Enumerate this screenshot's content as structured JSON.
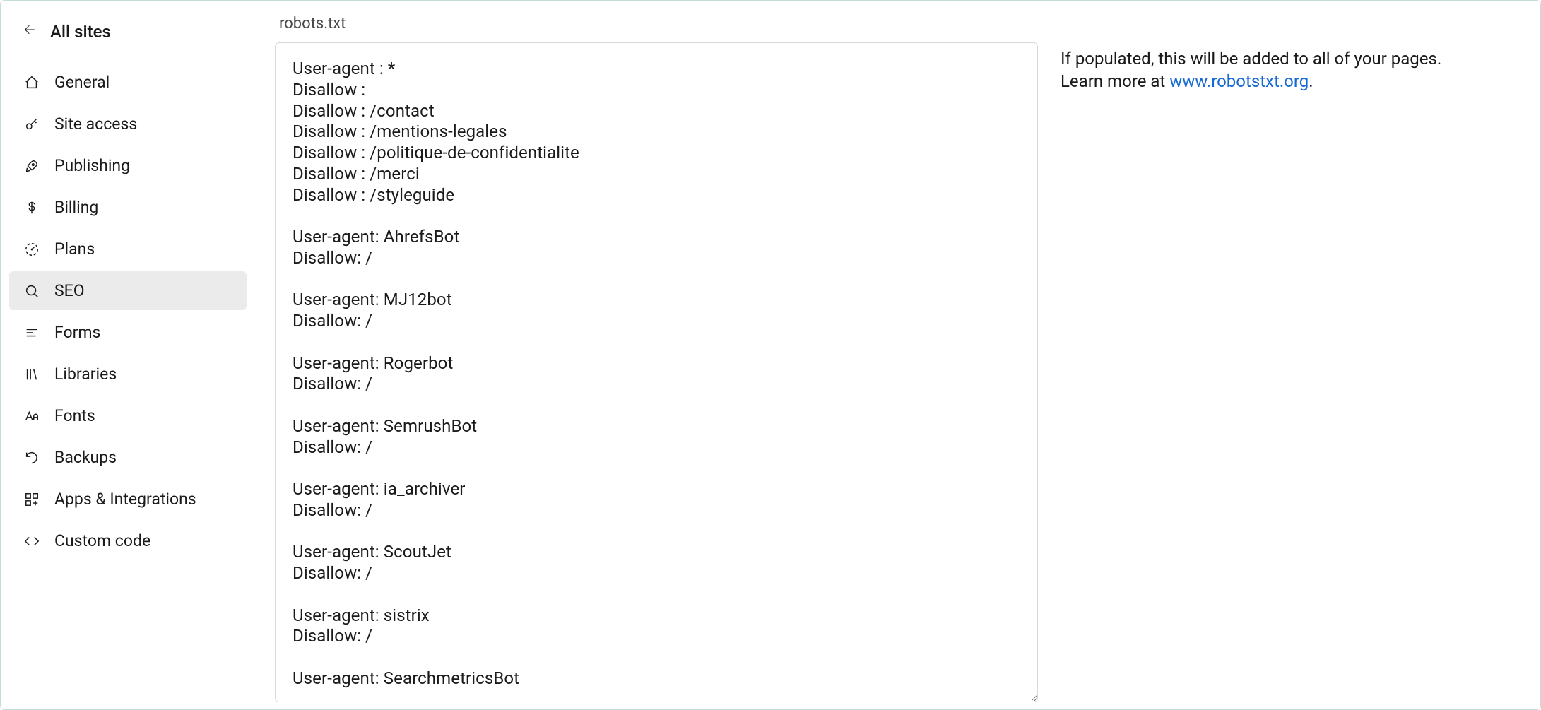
{
  "sidebar": {
    "back_label": "All sites",
    "items": [
      {
        "id": "general",
        "label": "General",
        "icon": "home-icon"
      },
      {
        "id": "access",
        "label": "Site access",
        "icon": "key-icon"
      },
      {
        "id": "publishing",
        "label": "Publishing",
        "icon": "rocket-icon"
      },
      {
        "id": "billing",
        "label": "Billing",
        "icon": "dollar-icon"
      },
      {
        "id": "plans",
        "label": "Plans",
        "icon": "gauge-icon"
      },
      {
        "id": "seo",
        "label": "SEO",
        "icon": "search-icon"
      },
      {
        "id": "forms",
        "label": "Forms",
        "icon": "lines-icon"
      },
      {
        "id": "libraries",
        "label": "Libraries",
        "icon": "library-icon"
      },
      {
        "id": "fonts",
        "label": "Fonts",
        "icon": "fonts-icon"
      },
      {
        "id": "backups",
        "label": "Backups",
        "icon": "undo-icon"
      },
      {
        "id": "apps",
        "label": "Apps & Integrations",
        "icon": "grid-plus-icon"
      },
      {
        "id": "code",
        "label": "Custom code",
        "icon": "code-icon"
      }
    ],
    "active_id": "seo"
  },
  "main": {
    "section_title": "robots.txt",
    "robots_value": "User-agent : *\nDisallow :\nDisallow : /contact\nDisallow : /mentions-legales\nDisallow : /politique-de-confidentialite\nDisallow : /merci\nDisallow : /styleguide\n\nUser-agent: AhrefsBot\nDisallow: /\n\nUser-agent: MJ12bot\nDisallow: /\n\nUser-agent: Rogerbot\nDisallow: /\n\nUser-agent: SemrushBot\nDisallow: /\n\nUser-agent: ia_archiver\nDisallow: /\n\nUser-agent: ScoutJet\nDisallow: /\n\nUser-agent: sistrix\nDisallow: /\n\nUser-agent: SearchmetricsBot"
  },
  "help": {
    "text_before_link": "If populated, this will be added to all of your pages. Learn more at ",
    "link_text": "www.robotstxt.org",
    "text_after_link": "."
  }
}
